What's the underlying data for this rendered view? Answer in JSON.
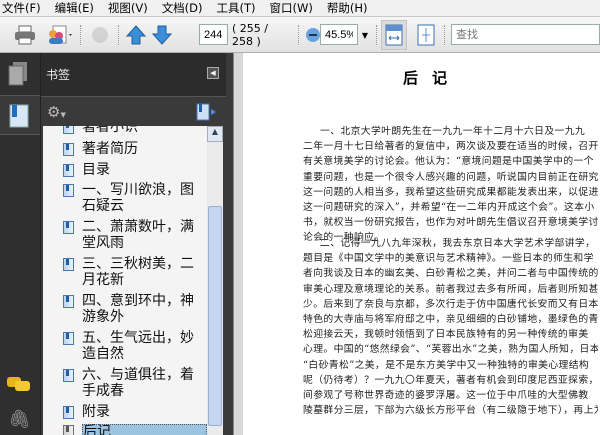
{
  "menu": [
    "文件(F)",
    "编辑(E)",
    "视图(V)",
    "文档(D)",
    "工具(T)",
    "窗口(W)",
    "帮助(H)"
  ],
  "toolbar": {
    "page_input": "244",
    "page_count": "( 255 / 258 )",
    "zoom": "45.5%",
    "search_placeholder": "查找"
  },
  "panel": {
    "title": "书签"
  },
  "bookmarks": [
    {
      "label": "著者小识"
    },
    {
      "label": "著者简历"
    },
    {
      "label": "目录"
    },
    {
      "label": "一、写川欲浪，图石疑云"
    },
    {
      "label": "二、萧萧数叶，满堂风雨"
    },
    {
      "label": "三、三秋树美，二月花新"
    },
    {
      "label": "四、意到环中，神游象外"
    },
    {
      "label": "五、生气远出，妙造自然"
    },
    {
      "label": "六、与道俱往，着手成春"
    },
    {
      "label": "附录"
    },
    {
      "label": "后记",
      "selected": true
    }
  ],
  "document": {
    "title": "后记",
    "lines": [
      "一、北京大学叶朗先生在一九九一年十二月十六日及一九九",
      "二年一月十七日给著者的复信中，两次谈及要在适当的时候，召开",
      "有关意境美学的讨论会。他认为：“意境问题是中国美学中的一个",
      "重要问题，也是一个很令人感兴趣的问题，听说国内目前正在研究",
      "这一问题的人相当多，我希望这些研究成果都能发表出来，以促进",
      "这一问题研究的深入”，并希望“在一二年内开成这个会”。这本小",
      "书，就权当一份研究报告，也作为对叶朗先生倡议召开意境美学讨",
      "论会的一种响应。",
      "二、记得一九八九年深秋，我去东京日本大学艺术学部讲学，",
      "题目是《中国文学中的美意识与艺术精神》。一些日本的师生和学",
      "者向我谈及日本的幽玄美、白砂青松之美，并问二者与中国传统的",
      "审美心理及意境理论的关系。前者我过去多有所闻，后者则所知甚",
      "少。后来到了奈良与京都，多次行走于仿中国唐代长安而又有日本",
      "特色的大寺庙与将军府邸之中，亲见细细的白砂铺地，墨绿色的青",
      "松迎接云天，我顿时领悟到了日本民族特有的另一种传统的审美",
      "心理。中国的“悠然绿会”、“芙蓉出水”之美，熟为国人所知，日本的",
      "“白砂青松”之美，是不是东方美学中又一种独特的审美心理结构",
      "呢（仍待考）？一九九〇年夏天，著者有机会到印度尼西亚探索，其",
      "间参观了号称世界奇迹的婆罗浮屠。这一位于中爪哇的大型佛教",
      "陵墓群分三层，下部为六级长方形平台（有二级隐于地下），再上为"
    ]
  }
}
